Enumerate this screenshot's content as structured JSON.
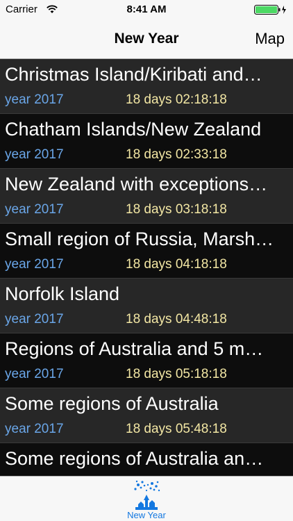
{
  "status": {
    "carrier": "Carrier",
    "time": "8:41 AM",
    "battery_color": "#4cd964"
  },
  "nav": {
    "title": "New Year",
    "right_button": "Map"
  },
  "rows": [
    {
      "title": "Christmas Island/Kiribati and…",
      "year": "year 2017",
      "countdown": "18 days 02:18:18"
    },
    {
      "title": "Chatham Islands/New Zealand",
      "year": "year 2017",
      "countdown": "18 days 02:33:18"
    },
    {
      "title": "New Zealand with exceptions…",
      "year": "year 2017",
      "countdown": "18 days 03:18:18"
    },
    {
      "title": "Small region of Russia, Marsh…",
      "year": "year 2017",
      "countdown": "18 days 04:18:18"
    },
    {
      "title": "Norfolk Island",
      "year": "year 2017",
      "countdown": "18 days 04:48:18"
    },
    {
      "title": "Regions of Australia and 5 m…",
      "year": "year 2017",
      "countdown": "18 days 05:18:18"
    },
    {
      "title": "Some regions of Australia",
      "year": "year 2017",
      "countdown": "18 days 05:48:18"
    },
    {
      "title": "Some regions of Australia an…",
      "year": "",
      "countdown": ""
    }
  ],
  "tab_bar": {
    "items": [
      {
        "label": "New Year",
        "icon": "fireworks-icon",
        "color": "#1478e0"
      }
    ]
  },
  "colors": {
    "year_text": "#6aa6e8",
    "countdown_text": "#f3e7a4",
    "row_odd": "#272727",
    "row_even": "#0d0d0d"
  }
}
